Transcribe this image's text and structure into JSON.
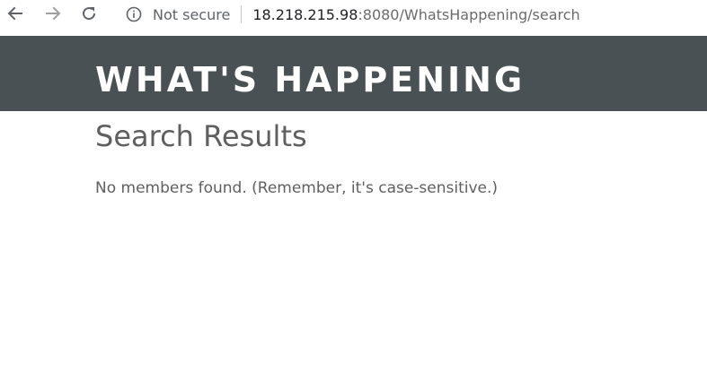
{
  "browser": {
    "icons": {
      "back": "arrow-left-icon",
      "forward": "arrow-right-icon",
      "reload": "reload-icon",
      "security": "info-circle-icon"
    },
    "security_label": "Not secure",
    "url_host": "18.218.215.98",
    "url_rest": ":8080/WhatsHappening/search"
  },
  "site": {
    "title": "WHAT'S HAPPENING",
    "header_color": "#4a5155"
  },
  "main": {
    "heading": "Search Results",
    "message": "No members found. (Remember, it's case-sensitive.)"
  }
}
